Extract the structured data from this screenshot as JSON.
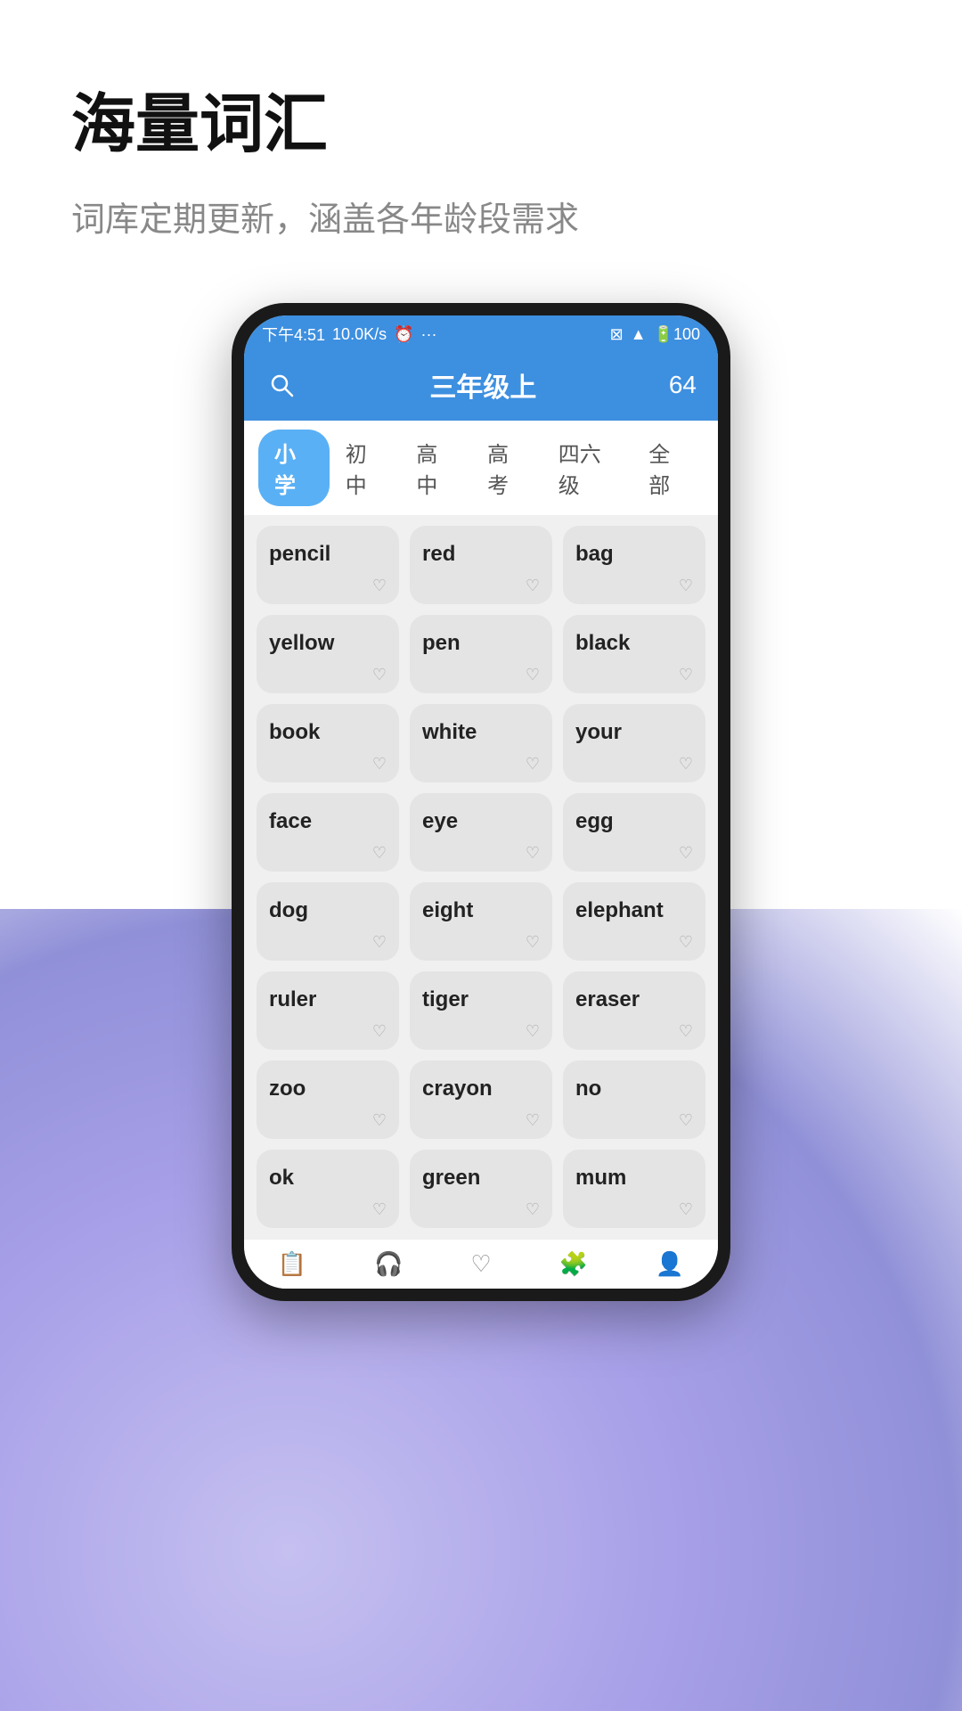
{
  "page": {
    "main_title": "海量词汇",
    "sub_title": "词库定期更新，涵盖各年龄段需求"
  },
  "status_bar": {
    "time": "下午4:51",
    "network": "10.0K/s",
    "icons": "⊠ ▲ 100"
  },
  "app_header": {
    "title": "三年级上",
    "word_count": "64",
    "search_label": "搜索"
  },
  "tabs": [
    {
      "label": "小学",
      "active": true
    },
    {
      "label": "初中",
      "active": false
    },
    {
      "label": "高中",
      "active": false
    },
    {
      "label": "高考",
      "active": false
    },
    {
      "label": "四六级",
      "active": false
    },
    {
      "label": "全部",
      "active": false
    }
  ],
  "words": [
    "pencil",
    "red",
    "bag",
    "yellow",
    "pen",
    "black",
    "book",
    "white",
    "your",
    "face",
    "eye",
    "egg",
    "dog",
    "eight",
    "elephant",
    "ruler",
    "tiger",
    "eraser",
    "zoo",
    "crayon",
    "no",
    "ok",
    "green",
    "mum"
  ],
  "bottom_nav": [
    {
      "icon": "📋",
      "label": "词汇"
    },
    {
      "icon": "🎧",
      "label": "学习"
    },
    {
      "icon": "♡",
      "label": "收藏"
    },
    {
      "icon": "🧩",
      "label": "拓展"
    },
    {
      "icon": "👤",
      "label": "我的"
    }
  ],
  "colors": {
    "accent_blue": "#3d8fe0",
    "tab_active": "#5ab0f5",
    "card_bg": "#e4e4e4",
    "page_bg": "#f0f0f0"
  }
}
